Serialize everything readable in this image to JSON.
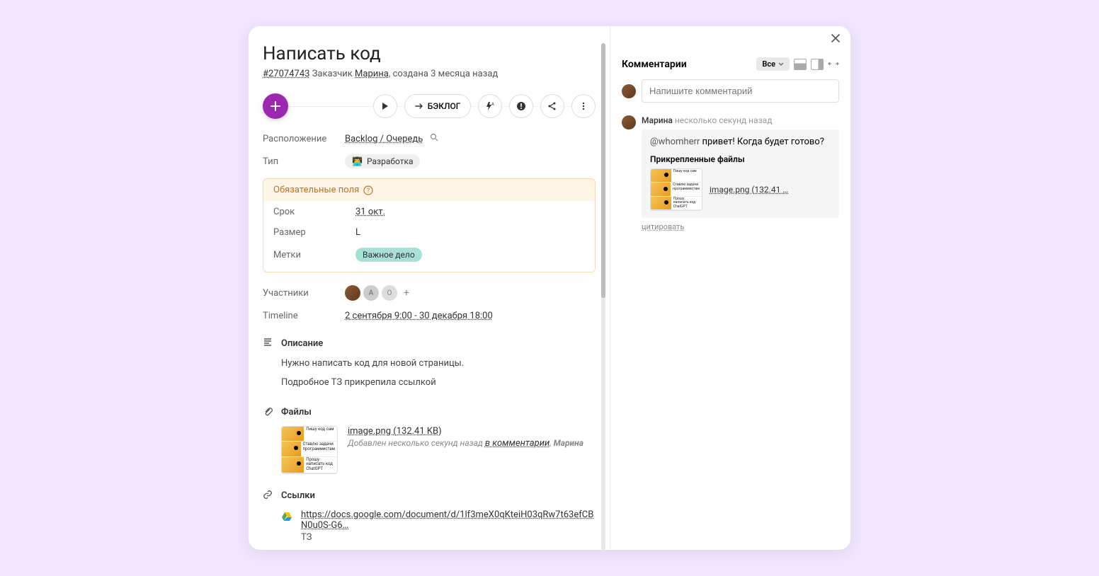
{
  "task": {
    "title": "Написать код",
    "id": "#27074743",
    "customer_label": "Заказчик",
    "customer_name": "Марина",
    "created_suffix": ", создана 3 месяца назад"
  },
  "toolbar": {
    "backlog_btn": "БЭКЛОГ"
  },
  "fields": {
    "location_label": "Расположение",
    "location_value": "Backlog / Очередь",
    "type_label": "Тип",
    "type_value": "Разработка",
    "required_header": "Обязательные поля",
    "deadline_label": "Срок",
    "deadline_value": "31 окт.",
    "size_label": "Размер",
    "size_value": "L",
    "tags_label": "Метки",
    "tag_value": "Важное дело",
    "participants_label": "Участники",
    "p_initials": [
      "А",
      "О"
    ],
    "timeline_label": "Timeline",
    "timeline_value": "2 сентября 9:00 - 30 декабря 18:00"
  },
  "sections": {
    "description_h": "Описание",
    "description_body": [
      "Нужно написать код для новой страницы.",
      "Подробное ТЗ прикрепила ссылкой"
    ],
    "files_h": "Файлы",
    "links_h": "Ссылки"
  },
  "file": {
    "name": "image.png (132.41 KB)",
    "added_prefix": "Добавлен несколько секунд назад ",
    "added_where": "в комментарии",
    "added_by_sep": ", ",
    "added_by": "Марина"
  },
  "meme": {
    "l1": "Пишу код сам",
    "l2": "Ставлю задачи программистам",
    "l3": "Прошу написать код ChatGPT"
  },
  "link": {
    "url": "https://docs.google.com/document/d/1lf3meX0qKteiH03qRw7t63efCBN0u0S-G6…",
    "label": "ТЗ"
  },
  "comments": {
    "header": "Комментарии",
    "filter_all": "Все",
    "input_placeholder": "Напишите комментарий",
    "author": "Марина",
    "time": "несколько секунд назад",
    "text_mention": "@whomherr",
    "text_rest": " привет! Когда будет готово?",
    "attached_h": "Прикрепленные файлы",
    "attached_name": "image.png (132.41 …",
    "quote": "цитировать"
  }
}
